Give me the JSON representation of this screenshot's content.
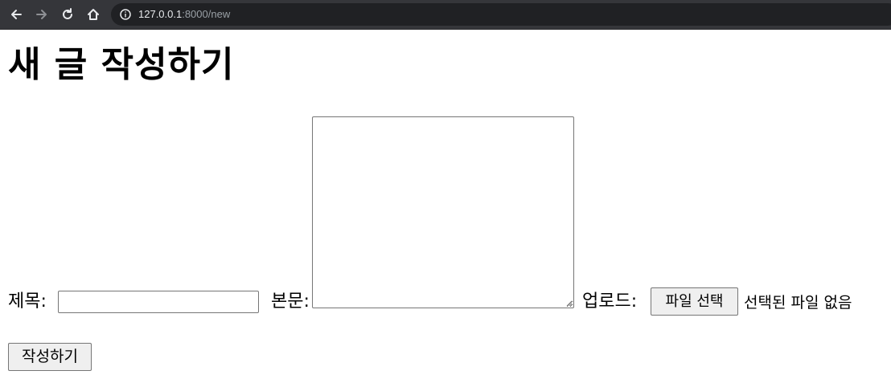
{
  "browser": {
    "url_host": "127.0.0.1",
    "url_rest": ":8000/new",
    "icons": [
      "back-arrow-icon",
      "forward-arrow-icon",
      "reload-icon",
      "home-icon",
      "info-icon"
    ]
  },
  "page": {
    "heading": "새 글 작성하기",
    "form": {
      "title_label": "제목:",
      "title_value": "",
      "body_label": "본문:",
      "body_value": "",
      "upload_label": "업로드:",
      "file_button_label": "파일 선택",
      "file_status": "선택된 파일 없음",
      "submit_label": "작성하기"
    }
  }
}
